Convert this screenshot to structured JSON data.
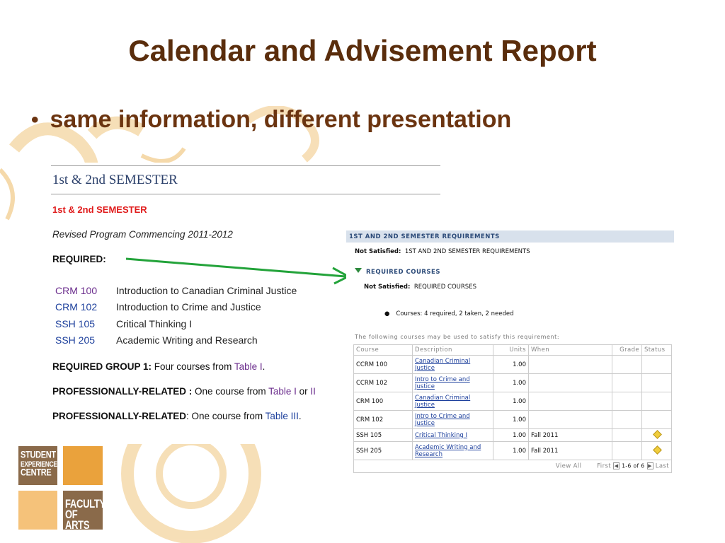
{
  "slide": {
    "title": "Calendar and Advisement Report",
    "bullet": "same information, different presentation"
  },
  "calendar": {
    "heading": "1st & 2nd SEMESTER",
    "subheading": "1st & 2nd SEMESTER",
    "program_note": "Revised Program Commencing 2011-2012",
    "required_label": "REQUIRED:",
    "courses": [
      {
        "code": "CRM 100",
        "title": "Introduction to Canadian Criminal Justice"
      },
      {
        "code": "CRM 102",
        "title": "Introduction to Crime and Justice"
      },
      {
        "code": "SSH 105",
        "title": "Critical Thinking I"
      },
      {
        "code": "SSH 205",
        "title": "Academic Writing and Research"
      }
    ],
    "group1_label": "REQUIRED GROUP 1:",
    "group1_text": " Four courses from ",
    "group1_link": "Table I",
    "group1_end": ".",
    "prof1_label": "PROFESSIONALLY-RELATED :",
    "prof1_text": " One course from ",
    "prof1_link1": "Table I",
    "prof1_or": " or ",
    "prof1_link2": "II",
    "prof2_label": "PROFESSIONALLY-RELATED",
    "prof2_text": ": One course from ",
    "prof2_link": "Table III",
    "prof2_end": "."
  },
  "advisement": {
    "header": "1ST AND 2ND SEMESTER REQUIREMENTS",
    "not_satisfied_label": "Not Satisfied:",
    "not_satisfied_1": "1ST AND 2ND SEMESTER REQUIREMENTS",
    "sub_header": "REQUIRED COURSES",
    "not_satisfied_2": "REQUIRED COURSES",
    "courses_summary": "Courses: 4 required, 2 taken, 2 needed",
    "note": "The following courses may be used to satisfy this requirement:",
    "columns": [
      "Course",
      "Description",
      "Units",
      "When",
      "Grade",
      "Status"
    ],
    "rows": [
      {
        "course": "CCRM 100",
        "desc": "Canadian Criminal Justice",
        "units": "1.00",
        "when": "",
        "grade": "",
        "status": ""
      },
      {
        "course": "CCRM 102",
        "desc": "Intro to Crime and Justice",
        "units": "1.00",
        "when": "",
        "grade": "",
        "status": ""
      },
      {
        "course": "CRM 100",
        "desc": "Canadian Criminal Justice",
        "units": "1.00",
        "when": "",
        "grade": "",
        "status": ""
      },
      {
        "course": "CRM 102",
        "desc": "Intro to Crime and Justice",
        "units": "1.00",
        "when": "",
        "grade": "",
        "status": ""
      },
      {
        "course": "SSH 105",
        "desc": "Critical Thinking I",
        "units": "1.00",
        "when": "Fall 2011",
        "grade": "",
        "status": "in-progress-icon"
      },
      {
        "course": "SSH 205",
        "desc": "Academic Writing and Research",
        "units": "1.00",
        "when": "Fall 2011",
        "grade": "",
        "status": "in-progress-icon"
      }
    ],
    "pager": {
      "view_all": "View All",
      "first": "First",
      "count": "1-6 of 6",
      "last": "Last"
    }
  },
  "logos": {
    "sec_line1": "STUDENT",
    "sec_line2": "EXPERIENCE",
    "sec_line3": "CENTRE",
    "foa_line1": "FACULTY",
    "foa_line2": "OF ARTS"
  },
  "colors": {
    "title": "#5a2d0c",
    "arrow": "#23a33a",
    "orange": "#eaa23c",
    "brown": "#8a6a4a"
  }
}
